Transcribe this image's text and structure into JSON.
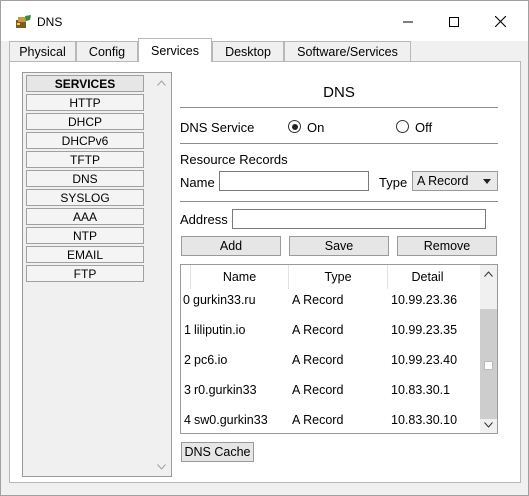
{
  "window": {
    "title": "DNS",
    "app_icon": "packet-tracer-icon",
    "controls": [
      "minimize-icon",
      "maximize-icon",
      "close-icon"
    ]
  },
  "tabs": [
    {
      "label": "Physical",
      "active": false
    },
    {
      "label": "Config",
      "active": false
    },
    {
      "label": "Services",
      "active": true
    },
    {
      "label": "Desktop",
      "active": false
    },
    {
      "label": "Software/Services",
      "active": false
    }
  ],
  "services": {
    "header": "SERVICES",
    "items": [
      "HTTP",
      "DHCP",
      "DHCPv6",
      "TFTP",
      "DNS",
      "SYSLOG",
      "AAA",
      "NTP",
      "EMAIL",
      "FTP"
    ]
  },
  "dns": {
    "heading": "DNS",
    "service_label": "DNS Service",
    "on_label": "On",
    "off_label": "Off",
    "service_state": "On",
    "resource_records_label": "Resource Records",
    "name_label": "Name",
    "name_value": "",
    "type_label": "Type",
    "type_selected": "A Record",
    "address_label": "Address",
    "address_value": "",
    "add_button": "Add",
    "save_button": "Save",
    "remove_button": "Remove",
    "cache_button": "DNS Cache"
  },
  "records_table": {
    "columns": [
      "",
      "Name",
      "Type",
      "Detail"
    ],
    "rows": [
      {
        "index": "0",
        "name": "gurkin33.ru",
        "type": "A Record",
        "detail": "10.99.23.36"
      },
      {
        "index": "1",
        "name": "liliputin.io",
        "type": "A Record",
        "detail": "10.99.23.35"
      },
      {
        "index": "2",
        "name": "pc6.io",
        "type": "A Record",
        "detail": "10.99.23.40"
      },
      {
        "index": "3",
        "name": "r0.gurkin33",
        "type": "A Record",
        "detail": "10.83.30.1"
      },
      {
        "index": "4",
        "name": "sw0.gurkin33",
        "type": "A Record",
        "detail": "10.83.30.10"
      }
    ]
  }
}
